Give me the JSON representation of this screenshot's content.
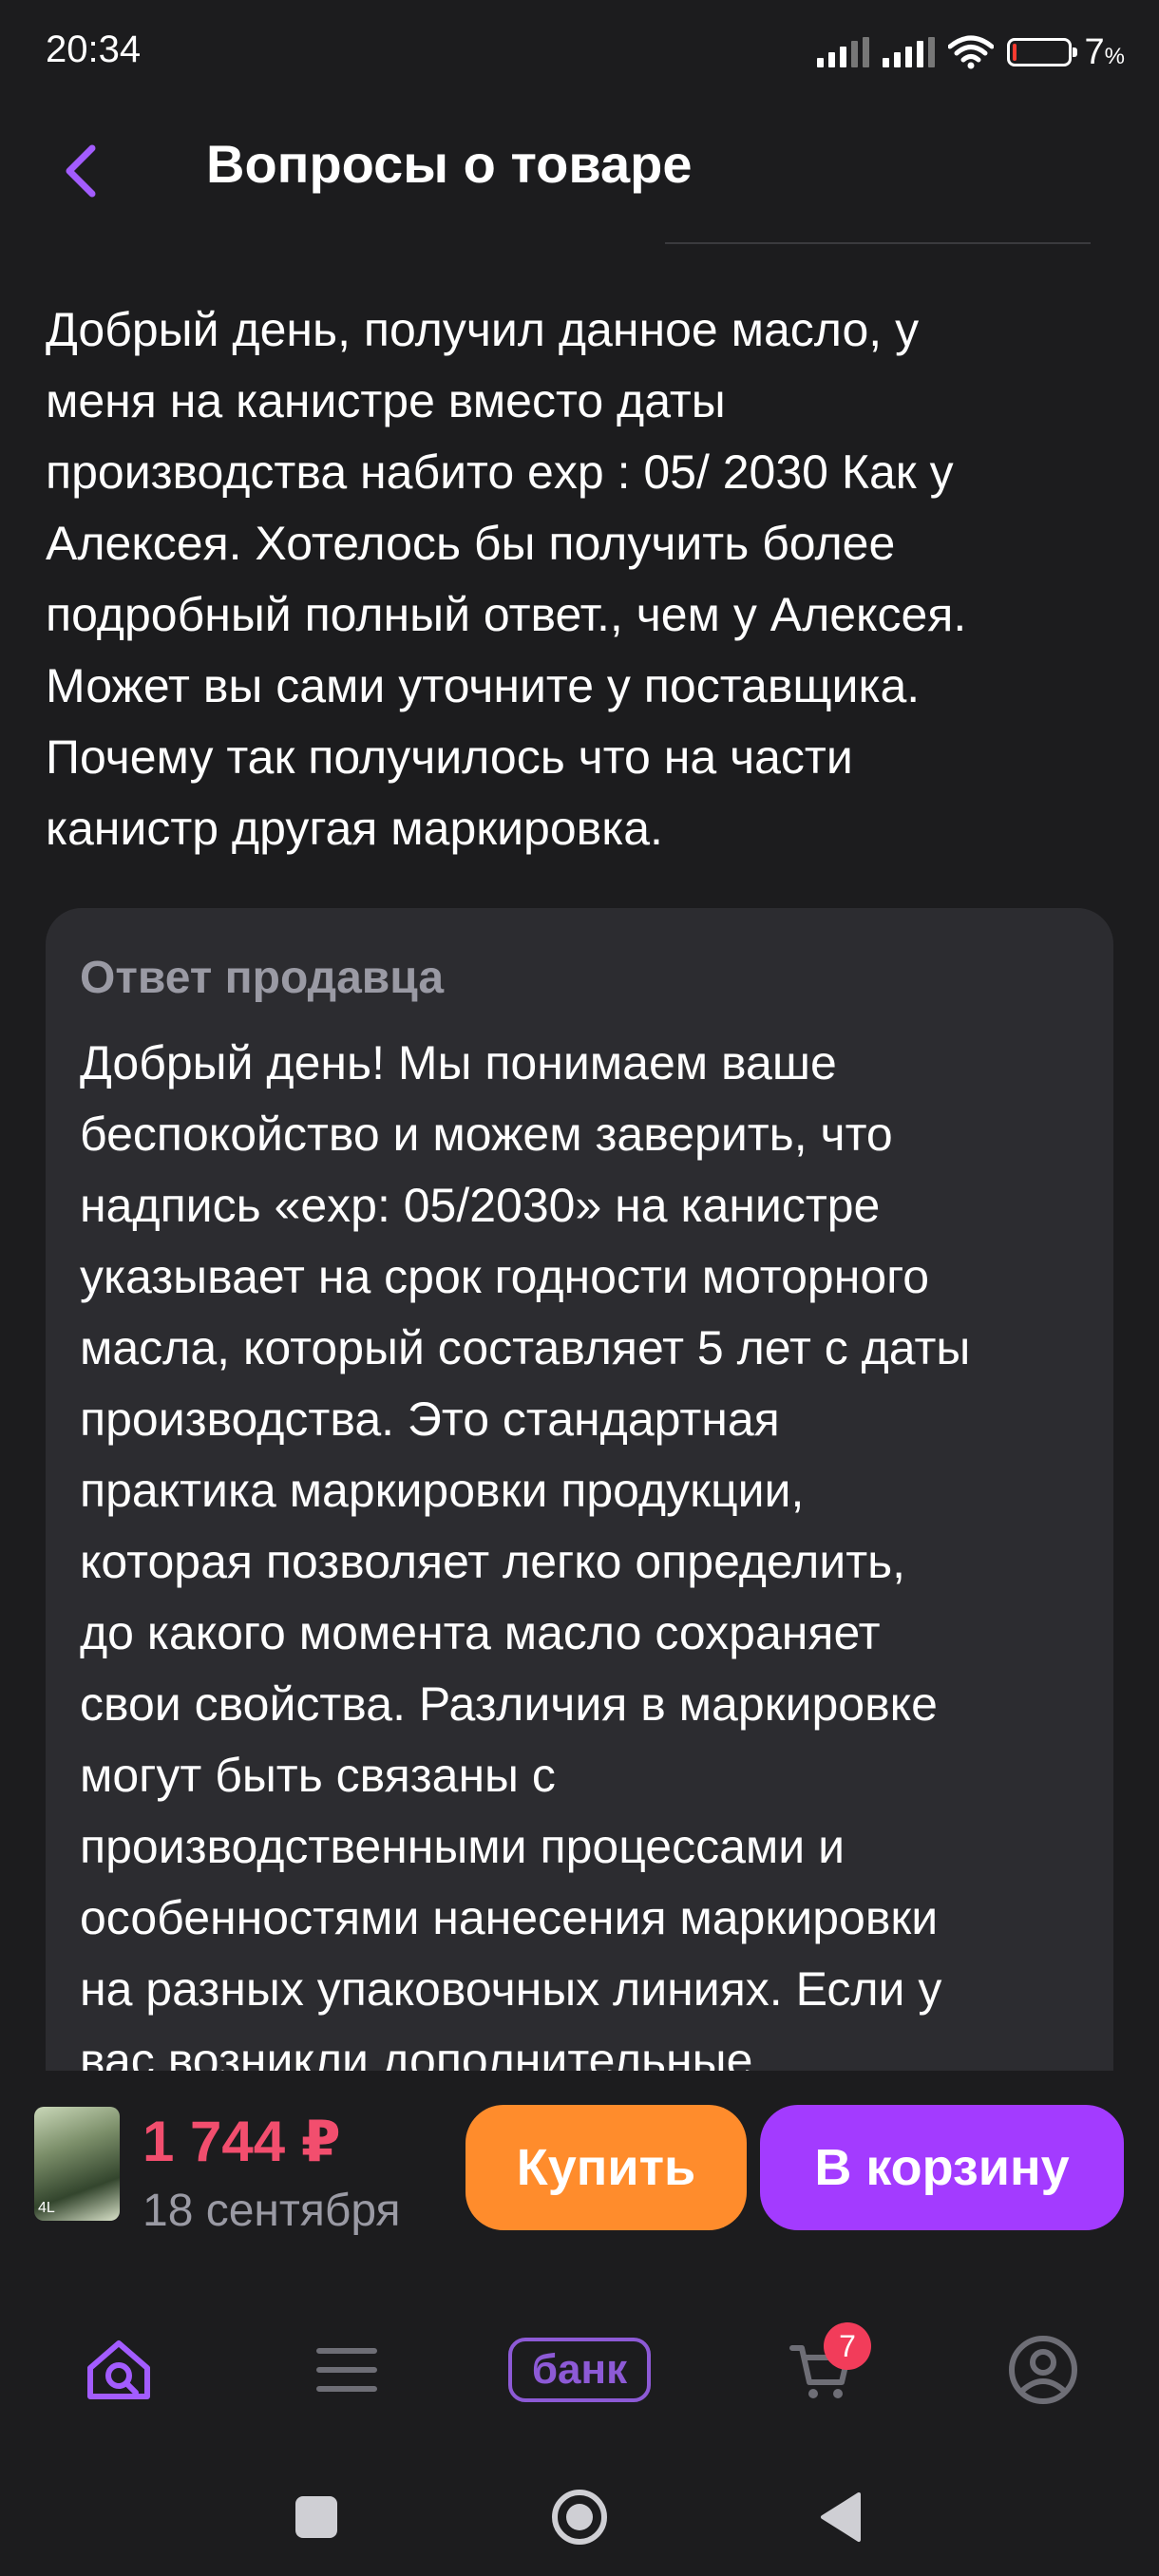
{
  "status_bar": {
    "time": "20:34",
    "battery_percent": "7",
    "battery_unit": "%",
    "battery_level": 0.07
  },
  "header": {
    "title": "Вопросы о товаре"
  },
  "question": {
    "text": "Добрый день, получил данное масло, у\nменя на канистре вместо даты\nпроизводства набито exp : 05/ 2030  Как у\nАлексея. Хотелось бы получить более\nподробный полный ответ., чем у Алексея.\nМожет вы сами уточните у поставщика.\nПочему так получилось что на части\nканистр другая маркировка."
  },
  "answer": {
    "label": "Ответ продавца",
    "text": "Добрый день! Мы понимаем ваше\nбеспокойство и можем заверить, что\nнадпись «exp: 05/2030» на канистре\nуказывает на срок годности моторного\nмасла, который составляет 5 лет с даты\nпроизводства. Это стандартная\nпрактика маркировки продукции,\nкоторая позволяет легко определить,\nдо какого момента масло сохраняет\nсвои свойства. Различия в маркировке\nмогут быть связаны с\nпроизводственными процессами и\nособенностями нанесения маркировки\nна разных упаковочных линиях. Если у\nвас возникли дополнительные"
  },
  "purchase": {
    "price": "1 744 ₽",
    "delivery_date": "18 сентября",
    "buy_label": "Купить",
    "cart_label": "В корзину",
    "thumb_text": "4L"
  },
  "bottom_nav": {
    "bank_label": "банк",
    "cart_count": "7"
  },
  "colors": {
    "background": "#1c1c1e",
    "card": "#2c2c30",
    "accent_purple": "#a33bff",
    "accent_orange": "#ff8c2c",
    "price_red": "#f24e6e",
    "muted_text": "#9a9aa4"
  }
}
